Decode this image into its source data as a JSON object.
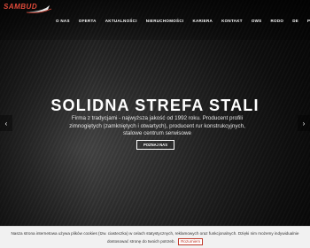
{
  "logo": {
    "text": "SAMBUD"
  },
  "nav": {
    "items": [
      "O NAS",
      "OFERTA",
      "AKTUALNOŚCI",
      "NIERUCHOMOŚCI",
      "KARIERA",
      "KONTAKT",
      "OWS",
      "RODO",
      "DE",
      "PL"
    ]
  },
  "hero": {
    "title": "SOLIDNA STREFA STALI",
    "description": "Firma z tradycjami - najwyższa jakość od 1992 roku. Producent profili zimnogiętych (zamkniętych i otwartych), producent rur konstrukcyjnych, stalowe centrum serwisowe",
    "cta_label": "Poznaj nas",
    "prev_arrow": "‹",
    "next_arrow": "›"
  },
  "cookie": {
    "line1": "Nasza strona internetowa używa plików cookies (tzw. ciasteczka) w celach statystycznych, reklamowych oraz funkcjonalnych. Dzięki nim możemy indywidualnie",
    "line2": "dostosować stronę do twoich potrzeb.",
    "button_label": "Rozumiem"
  },
  "colors": {
    "brand": "#e04a3a",
    "cookie_bg": "#f1f1f1",
    "cookie_button": "#c0392b"
  }
}
